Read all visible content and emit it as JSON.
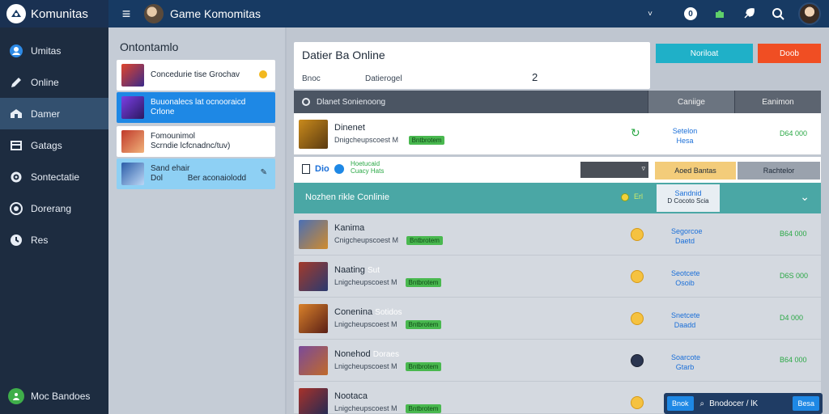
{
  "topbar": {
    "brand": "Komunitas",
    "app_title": "Game Komomitas",
    "chevron": "˅",
    "notif_count": "0"
  },
  "sidebar": {
    "items": [
      {
        "label": "Umitas",
        "icon": "user-circle-icon"
      },
      {
        "label": "Online",
        "icon": "pencil-icon"
      },
      {
        "label": "Damer",
        "icon": "shield-icon"
      },
      {
        "label": "Gatags",
        "icon": "box-icon"
      },
      {
        "label": "Sontectatie",
        "icon": "gear-icon"
      },
      {
        "label": "Dorerang",
        "icon": "globe-icon"
      },
      {
        "label": "Res",
        "icon": "clock-icon"
      }
    ],
    "active_index": 2,
    "footer_label": "Moc Bandoes"
  },
  "threads": {
    "heading": "Ontontamlo",
    "items": [
      {
        "title": "Concedurie tise Grochav",
        "sub": "",
        "style": "white",
        "badge": "dot"
      },
      {
        "title": "Buuonalecs lat ocnooraicd",
        "sub": "Crlone",
        "style": "blue",
        "badge": ""
      },
      {
        "title": "Fomounimol",
        "sub": "Scrndie lcfcnadnc/tuv)",
        "style": "white",
        "badge": ""
      },
      {
        "title": "Sand ehair",
        "sub": "Dol",
        "extra": "Ber aconaiolodd",
        "style": "light",
        "badge": "edit"
      }
    ]
  },
  "main": {
    "title": "Datier Ba Online",
    "sub_label": "Bnoc",
    "sub_value": "Datierogel",
    "count": "2",
    "btn_teal": "Noriloat",
    "btn_red": "Doob",
    "header": {
      "main": "Dlanet Sonienoong",
      "col1": "Caniige",
      "col2": "Eanimon"
    },
    "first_row": {
      "name": "Dinenet",
      "meta": "Dnigcheupscoest M",
      "pill": "Bntbrotem",
      "link": "Setelon\nHesa",
      "green": "D64 000"
    },
    "select_row": {
      "label": "Dio",
      "hint": "Hoetucaid\nCuacy Hats",
      "btn1": "Aoed Bantas",
      "btn2": "Rachtelor"
    },
    "teal_row": {
      "label": "Nozhen rikle Conlinie",
      "tag": "Erl",
      "btn_main": "Sandnid",
      "btn_sub": "D Cocoto Scia"
    },
    "rows": [
      {
        "name": "Kanima",
        "tag": "",
        "meta": "Cnigcheupscoest M",
        "pill": "Bntbrotem",
        "link": "Segorcoe\nDaetd",
        "green": "B64 000"
      },
      {
        "name": "Naating",
        "tag": "Sut",
        "meta": "Lnigcheupscoest M",
        "pill": "Bntbrotem",
        "link": "Seotcete\nOsoib",
        "green": "D6S 000"
      },
      {
        "name": "Conenina",
        "tag": "Sotidos",
        "meta": "Lnigcheupscoest M",
        "pill": "Bntbrotem",
        "link": "Snetcete\nDaadd",
        "green": "D4 000"
      },
      {
        "name": "Nonehod",
        "tag": "Doraes",
        "meta": "Lnigcheupscoest M",
        "pill": "Bntbrotem",
        "link": "Soarcote\nGtarb",
        "green": "B64 000"
      },
      {
        "name": "Nootaca",
        "tag": "",
        "meta": "Lnigcheupscoest M",
        "pill": "Bntbrotem",
        "link": "",
        "green": ""
      }
    ],
    "bottom_bar": {
      "btn_left": "Bnok",
      "text": "Bnodocer / lK",
      "btn_right": "Besa"
    }
  },
  "colors": {
    "accent": "#1e88e5",
    "topbar": "#173a63",
    "sidebar": "#1d2c40",
    "teal": "#1fb0c8",
    "red": "#f04e23",
    "green": "#49b84f"
  }
}
